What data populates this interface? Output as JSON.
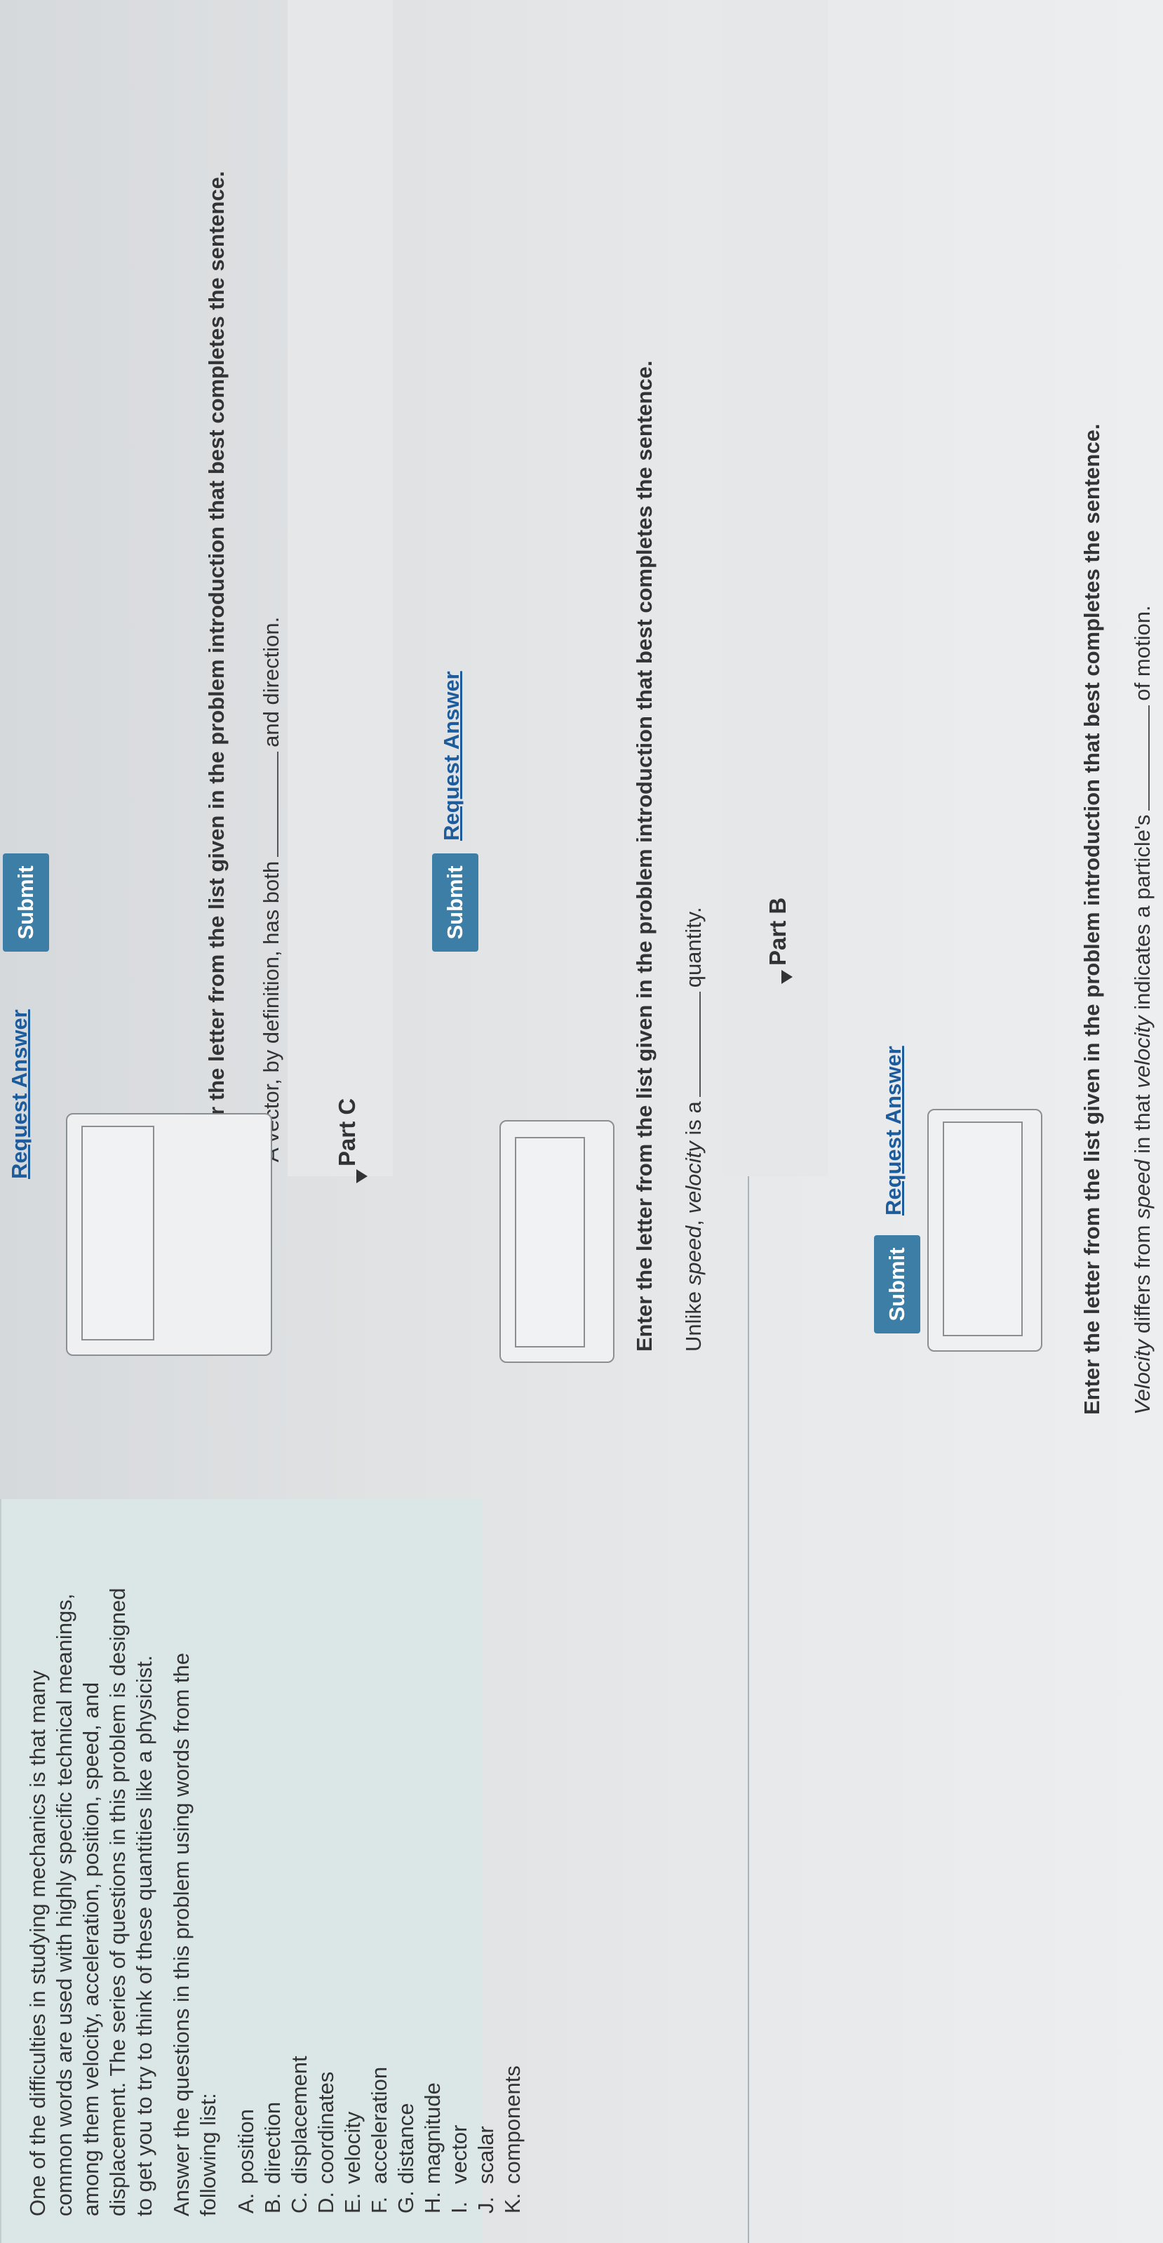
{
  "intro": {
    "paragraph_lines": [
      "One of the difficulties in studying mechanics is that many",
      "common words are used with highly specific technical meanings,",
      "among them velocity, acceleration, position, speed, and",
      "displacement. The series of questions in this problem is designed",
      "to get you to try to think of these quantities like a physicist."
    ],
    "answer_lines": [
      "Answer the questions in this problem using words from the",
      "following list:"
    ],
    "list": [
      {
        "letter": "A.",
        "word": "position"
      },
      {
        "letter": "B.",
        "word": "direction"
      },
      {
        "letter": "C.",
        "word": "displacement"
      },
      {
        "letter": "D.",
        "word": "coordinates"
      },
      {
        "letter": "E.",
        "word": "velocity"
      },
      {
        "letter": "F.",
        "word": "acceleration"
      },
      {
        "letter": "G.",
        "word": "distance"
      },
      {
        "letter": "H.",
        "word": "magnitude"
      },
      {
        "letter": "I.",
        "word": "vector"
      },
      {
        "letter": "J.",
        "word": "scalar"
      },
      {
        "letter": "K.",
        "word": "components"
      }
    ]
  },
  "part_a": {
    "q_pre1": "Velocity",
    "q_pre2": " differs from ",
    "q_pre3": "speed",
    "q_pre4": " in that ",
    "q_pre5": "velocity",
    "q_pre6": " indicates a particle's",
    "q_post": "of motion.",
    "instruction": "Enter the letter from the list given in the problem introduction that best completes the sentence.",
    "submit": "Submit",
    "request": "Request Answer"
  },
  "part_b": {
    "title": "Part B",
    "q_pre1": "Unlike ",
    "q_pre2": "speed",
    "q_pre3": ", ",
    "q_pre4": "velocity",
    "q_pre5": " is a",
    "q_post": "quantity.",
    "instruction": "Enter the letter from the list given in the problem introduction that best completes the sentence.",
    "submit": "Submit",
    "request": "Request Answer"
  },
  "part_c": {
    "title": "Part C",
    "q_pre": "A vector, by definition, has both",
    "q_post": "and direction.",
    "instruction": "Enter the letter from the list given in the problem introduction that best completes the sentence.",
    "submit": "Submit",
    "request": "Request Answer"
  }
}
